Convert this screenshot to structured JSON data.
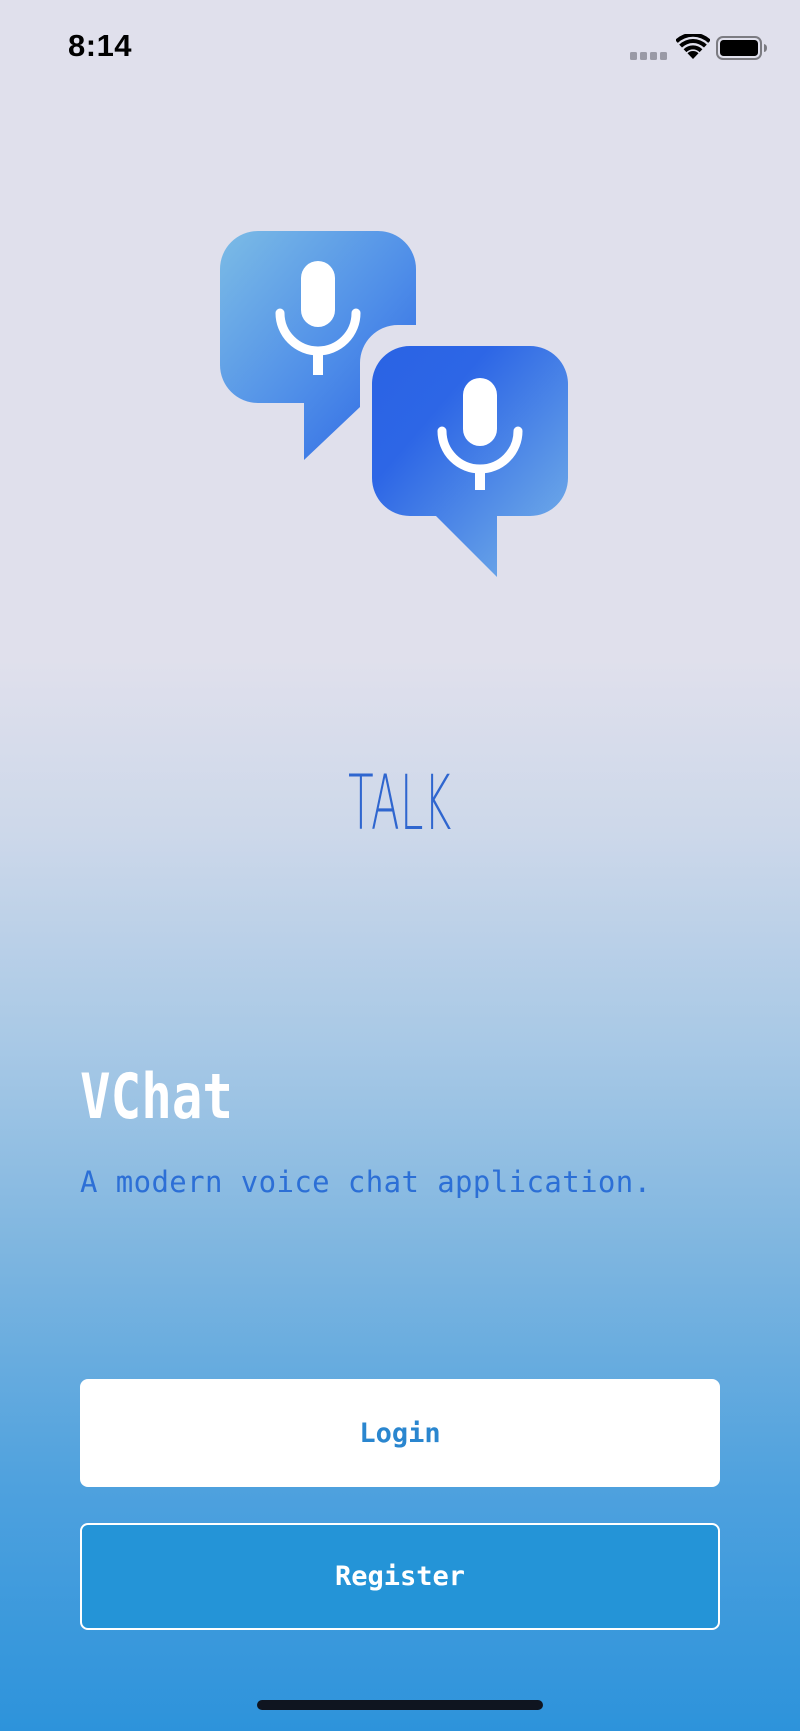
{
  "status_bar": {
    "time": "8:14",
    "icons": [
      "signal-icon",
      "wifi-icon",
      "battery-icon"
    ]
  },
  "logo": {
    "icon": "voice-chat-bubbles-icon",
    "brand_colors": [
      "#7ab8e6",
      "#2a63e4"
    ]
  },
  "talk_label": "TALK",
  "app": {
    "name": "VChat",
    "tagline": "A modern voice chat application."
  },
  "buttons": {
    "login_label": "Login",
    "register_label": "Register"
  },
  "colors": {
    "accent": "#2494d7",
    "tagline": "#2c6fd6",
    "talk": "#2f66cf"
  }
}
